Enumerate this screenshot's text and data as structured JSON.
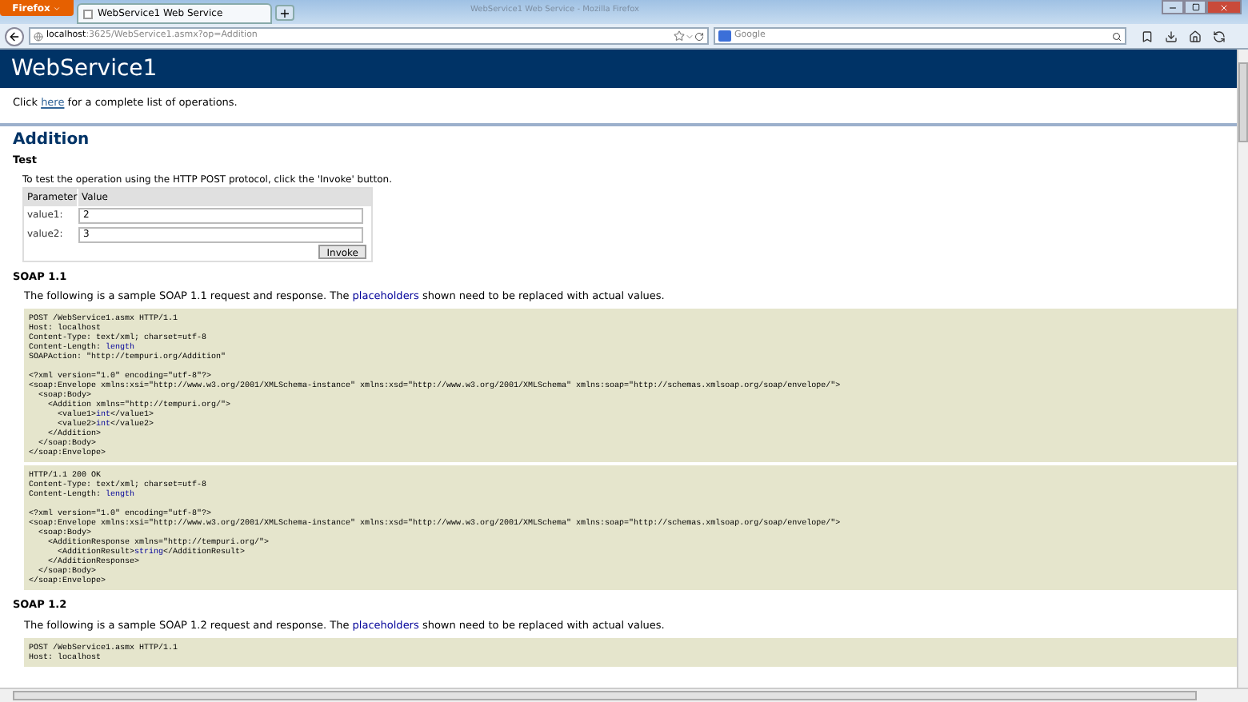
{
  "browser": {
    "menu_button": "Firefox",
    "window_title": "WebService1 Web Service - Mozilla Firefox",
    "tabs": [
      {
        "label": "WebService1 Web Service",
        "selected": true
      }
    ],
    "new_tab": "+",
    "url_host": "localhost",
    "url_rest": ":3625/WebService1.asmx?op=Addition",
    "search_placeholder": "Google"
  },
  "page": {
    "title": "WebService1",
    "intro": {
      "before": "Click ",
      "link": "here",
      "after": " for a complete list of operations."
    },
    "operation": "Addition",
    "test": {
      "heading": "Test",
      "instructions": "To test the operation using the HTTP POST protocol, click the 'Invoke' button.",
      "columns": [
        "Parameter",
        "Value"
      ],
      "params": [
        {
          "label": "value1:",
          "value": "2"
        },
        {
          "label": "value2:",
          "value": "3"
        }
      ],
      "button": "Invoke"
    },
    "sections": [
      {
        "heading": "SOAP 1.1",
        "description": {
          "before": "The following is a sample SOAP 1.1 request and response. The ",
          "link": "placeholders",
          "after": " shown need to be replaced with actual values."
        },
        "blocks": [
          [
            [
              {
                "text": "POST /WebService1.asmx HTTP/1.1"
              },
              {
                "text": "Host: localhost"
              },
              {
                "text": "Content-Type: text/xml; charset=utf-8"
              },
              {
                "text": "Content-Length: ",
                "placeholder": "length"
              },
              {
                "text": "SOAPAction: \"http://tempuri.org/Addition\""
              }
            ],
            [
              {
                "text": "<?xml version=\"1.0\" encoding=\"utf-8\"?>"
              },
              {
                "text": "<soap:Envelope xmlns:xsi=\"http://www.w3.org/2001/XMLSchema-instance\" xmlns:xsd=\"http://www.w3.org/2001/XMLSchema\" xmlns:soap=\"http://schemas.xmlsoap.org/soap/envelope/\">"
              },
              {
                "text": "  <soap:Body>"
              },
              {
                "text": "    <Addition xmlns=\"http://tempuri.org/\">"
              },
              {
                "text": "      <value1>",
                "placeholder": "int",
                "after": "</value1>"
              },
              {
                "text": "      <value2>",
                "placeholder": "int",
                "after": "</value2>"
              },
              {
                "text": "    </Addition>"
              },
              {
                "text": "  </soap:Body>"
              },
              {
                "text": "</soap:Envelope>"
              }
            ]
          ],
          [
            [
              {
                "text": "HTTP/1.1 200 OK"
              },
              {
                "text": "Content-Type: text/xml; charset=utf-8"
              },
              {
                "text": "Content-Length: ",
                "placeholder": "length"
              }
            ],
            [
              {
                "text": "<?xml version=\"1.0\" encoding=\"utf-8\"?>"
              },
              {
                "text": "<soap:Envelope xmlns:xsi=\"http://www.w3.org/2001/XMLSchema-instance\" xmlns:xsd=\"http://www.w3.org/2001/XMLSchema\" xmlns:soap=\"http://schemas.xmlsoap.org/soap/envelope/\">"
              },
              {
                "text": "  <soap:Body>"
              },
              {
                "text": "    <AdditionResponse xmlns=\"http://tempuri.org/\">"
              },
              {
                "text": "      <AdditionResult>",
                "placeholder": "string",
                "after": "</AdditionResult>"
              },
              {
                "text": "    </AdditionResponse>"
              },
              {
                "text": "  </soap:Body>"
              },
              {
                "text": "</soap:Envelope>"
              }
            ]
          ]
        ]
      },
      {
        "heading": "SOAP 1.2",
        "description": {
          "before": "The following is a sample SOAP 1.2 request and response. The ",
          "link": "placeholders",
          "after": " shown need to be replaced with actual values."
        },
        "blocks": [
          [
            [
              {
                "text": "POST /WebService1.asmx HTTP/1.1"
              },
              {
                "text": "Host: localhost"
              }
            ]
          ]
        ]
      }
    ]
  }
}
